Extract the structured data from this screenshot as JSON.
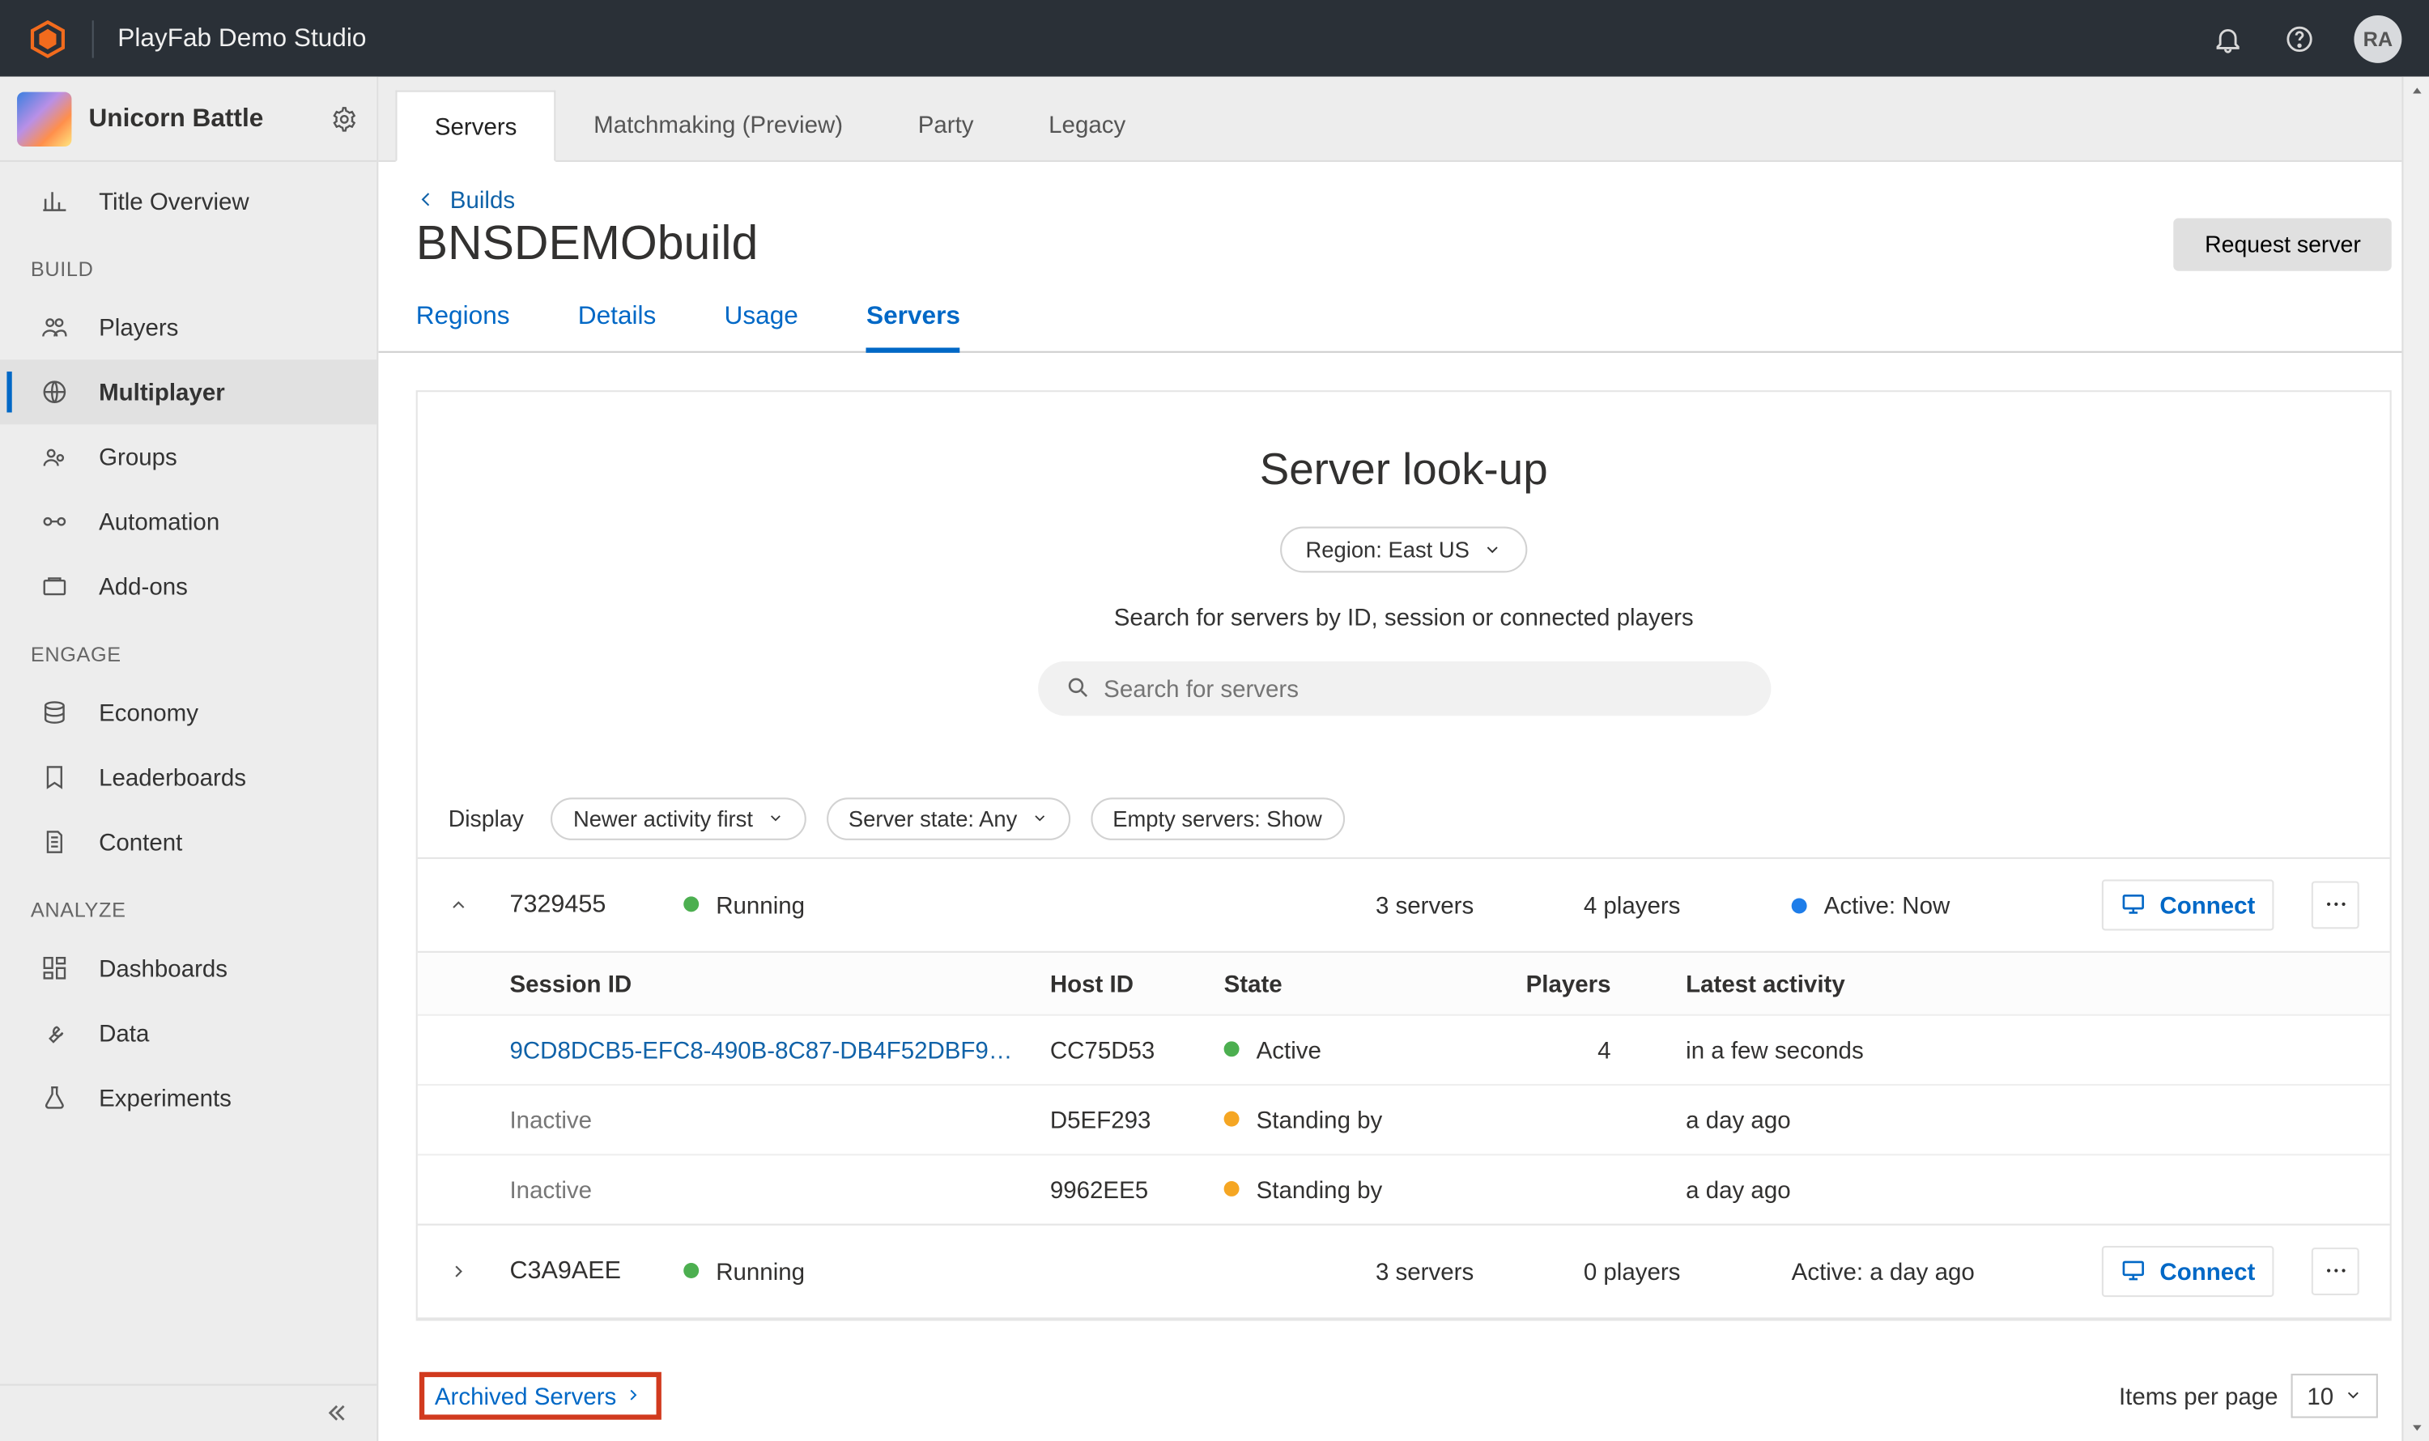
{
  "header": {
    "studio": "PlayFab Demo Studio",
    "avatar": "RA"
  },
  "game": {
    "name": "Unicorn Battle"
  },
  "sidebar": {
    "overview": "Title Overview",
    "sections": {
      "build": "BUILD",
      "engage": "ENGAGE",
      "analyze": "ANALYZE"
    },
    "items": {
      "players": "Players",
      "multiplayer": "Multiplayer",
      "groups": "Groups",
      "automation": "Automation",
      "addons": "Add-ons",
      "economy": "Economy",
      "leaderboards": "Leaderboards",
      "content": "Content",
      "dashboards": "Dashboards",
      "data": "Data",
      "experiments": "Experiments"
    }
  },
  "toptabs": {
    "servers": "Servers",
    "matchmaking": "Matchmaking (Preview)",
    "party": "Party",
    "legacy": "Legacy"
  },
  "page": {
    "back": "Builds",
    "title": "BNSDEMObuild",
    "request_server": "Request server",
    "subtabs": {
      "regions": "Regions",
      "details": "Details",
      "usage": "Usage",
      "servers": "Servers"
    }
  },
  "lookup": {
    "title": "Server look-up",
    "region_label": "Region: East US",
    "subtitle": "Search for servers by ID, session or connected players",
    "search_placeholder": "Search for servers"
  },
  "filters": {
    "display": "Display",
    "sort": "Newer activity first",
    "state": "Server state: Any",
    "empty": "Empty servers: Show"
  },
  "groups": [
    {
      "id": "7329455",
      "status_label": "Running",
      "servers": "3 servers",
      "players": "4 players",
      "activity": "Active: Now",
      "connect": "Connect",
      "expanded": true,
      "columns": {
        "session": "Session ID",
        "host": "Host ID",
        "state": "State",
        "players": "Players",
        "latest": "Latest activity"
      },
      "rows": [
        {
          "session": "9CD8DCB5-EFC8-490B-8C87-DB4F52DBF9…",
          "session_active": true,
          "host": "CC75D53",
          "state": "Active",
          "state_color": "green",
          "players": "4",
          "latest": "in a few seconds"
        },
        {
          "session": "Inactive",
          "session_active": false,
          "host": "D5EF293",
          "state": "Standing by",
          "state_color": "orange",
          "players": "",
          "latest": "a day ago"
        },
        {
          "session": "Inactive",
          "session_active": false,
          "host": "9962EE5",
          "state": "Standing by",
          "state_color": "orange",
          "players": "",
          "latest": "a day ago"
        }
      ]
    },
    {
      "id": "C3A9AEE",
      "status_label": "Running",
      "servers": "3 servers",
      "players": "0 players",
      "activity": "Active: a day ago",
      "connect": "Connect",
      "expanded": false
    }
  ],
  "footer": {
    "archived": "Archived Servers",
    "perpage_label": "Items per page",
    "perpage_value": "10"
  }
}
